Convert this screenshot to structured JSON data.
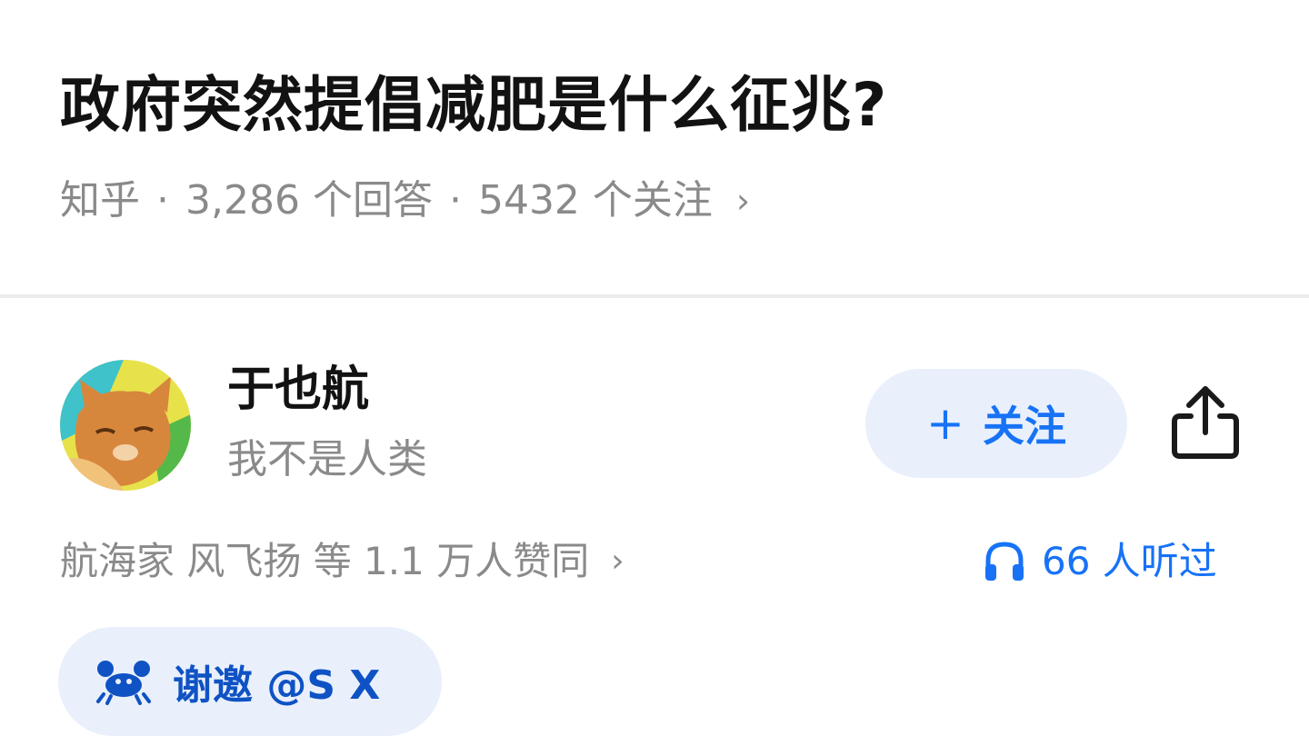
{
  "question": {
    "title": "政府突然提倡减肥是什么征兆?",
    "source": "知乎",
    "answers": "3,286 个回答",
    "followers": "5432 个关注",
    "separator": "·",
    "chevron": "›"
  },
  "author": {
    "name": "于也航",
    "bio": "我不是人类",
    "avatar_icon": "cat-avatar"
  },
  "actions": {
    "follow_plus": "+",
    "follow_label": "关注",
    "share_icon": "share-icon"
  },
  "stats": {
    "votes_text": "航海家 风飞扬 等 1.1 万人赞同",
    "votes_chevron": "›",
    "listen_text": "66 人听过",
    "listen_icon": "headphones-icon"
  },
  "invite": {
    "label": "谢邀 @S X",
    "icon": "crab-icon"
  },
  "colors": {
    "accent": "#1772f6",
    "accent_bg": "#e9f0fc",
    "muted_text": "#8a8a8a",
    "divider": "#ececec"
  }
}
